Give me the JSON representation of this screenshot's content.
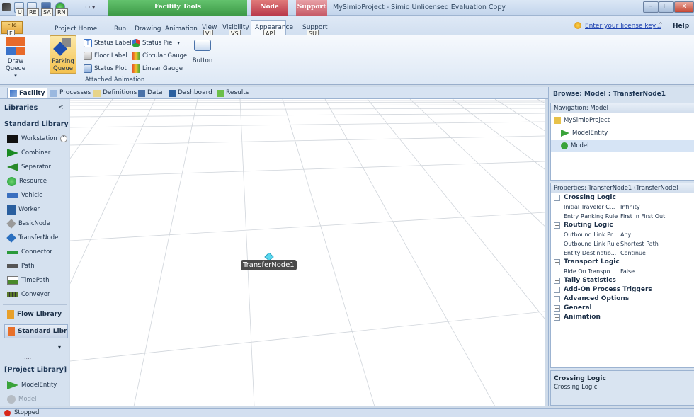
{
  "window": {
    "title": "MySimioProject - Simio Unlicensed Evaluation Copy",
    "context_tabs": [
      "Facility Tools",
      "Node Tools",
      "Support"
    ],
    "min": "–",
    "max": "□",
    "close": "x"
  },
  "qat_keytips": [
    "U",
    "RE",
    "SA",
    "RN"
  ],
  "ribbon_tabs": [
    {
      "label": "File",
      "keytip": "F"
    },
    {
      "label": "Project Home",
      "keytip": ""
    },
    {
      "label": "Run",
      "keytip": ""
    },
    {
      "label": "Drawing",
      "keytip": ""
    },
    {
      "label": "Animation",
      "keytip": ""
    },
    {
      "label": "View",
      "keytip": "VI"
    },
    {
      "label": "Visibility",
      "keytip": "VS"
    },
    {
      "label": "Appearance",
      "keytip": "AP"
    },
    {
      "label": "Support",
      "keytip": "SU"
    }
  ],
  "license": {
    "link": "Enter your license key...",
    "help": "Help"
  },
  "ribbon": {
    "draw_queue": "Draw Queue",
    "parking_queue": "Parking Queue",
    "status_label": "Status Label",
    "floor_label": "Floor Label",
    "status_plot": "Status Plot",
    "status_pie": "Status Pie",
    "circular_gauge": "Circular Gauge",
    "linear_gauge": "Linear Gauge",
    "button": "Button",
    "group_label": "Attached Animation"
  },
  "doc_tabs": [
    "Facility",
    "Processes",
    "Definitions",
    "Data",
    "Dashboard",
    "Results"
  ],
  "libraries": {
    "header": "Libraries",
    "collapse": "<",
    "standard_header": "Standard Library",
    "items": [
      {
        "label": "Workstation",
        "icon": "workstation-icon",
        "color": "#1a8a22"
      },
      {
        "label": "Combiner",
        "icon": "combiner-icon",
        "color": "#1a8a22"
      },
      {
        "label": "Separator",
        "icon": "separator-icon",
        "color": "#2a8a2a"
      },
      {
        "label": "Resource",
        "icon": "resource-icon",
        "color": "#1f9a3a"
      },
      {
        "label": "Vehicle",
        "icon": "vehicle-icon",
        "color": "#3a6fbf"
      },
      {
        "label": "Worker",
        "icon": "worker-icon",
        "color": "#2a5f9f"
      },
      {
        "label": "BasicNode",
        "icon": "basicnode-icon",
        "color": "#9a9a9a"
      },
      {
        "label": "TransferNode",
        "icon": "transfernode-icon",
        "color": "#2a6fbf"
      },
      {
        "label": "Connector",
        "icon": "connector-icon",
        "color": "#2a9a3a"
      },
      {
        "label": "Path",
        "icon": "path-icon",
        "color": "#555555"
      },
      {
        "label": "TimePath",
        "icon": "timepath-icon",
        "color": "#4a8a2a"
      },
      {
        "label": "Conveyor",
        "icon": "conveyor-icon",
        "color": "#5a7a2a"
      }
    ],
    "flow_library": "Flow Library",
    "standard_library_btn": "Standard Libr",
    "more": "....",
    "project_header": "[Project Library]",
    "project_items": [
      "ModelEntity",
      "Model"
    ]
  },
  "canvas": {
    "node_label": "TransferNode1"
  },
  "browse": {
    "title": "Browse: Model : TransferNode1",
    "nav_header": "Navigation: Model",
    "nav_items": [
      "MySimioProject",
      "ModelEntity",
      "Model"
    ],
    "props_header": "Properties: TransferNode1 (TransferNode)",
    "properties": [
      {
        "type": "cat",
        "sign": "−",
        "label": "Crossing Logic"
      },
      {
        "type": "prop",
        "label": "Initial Traveler C...",
        "value": "Infinity"
      },
      {
        "type": "prop",
        "label": "Entry Ranking Rule",
        "value": "First In First Out"
      },
      {
        "type": "cat",
        "sign": "−",
        "label": "Routing Logic"
      },
      {
        "type": "prop",
        "label": "Outbound Link Pr...",
        "value": "Any"
      },
      {
        "type": "prop",
        "label": "Outbound Link Rule",
        "value": "Shortest Path"
      },
      {
        "type": "prop",
        "label": "Entity Destinatio...",
        "value": "Continue"
      },
      {
        "type": "cat",
        "sign": "−",
        "label": "Transport Logic"
      },
      {
        "type": "prop",
        "label": "Ride On Transpo...",
        "value": "False"
      },
      {
        "type": "cat",
        "sign": "+",
        "label": "Tally Statistics"
      },
      {
        "type": "cat",
        "sign": "+",
        "label": "Add-On Process Triggers"
      },
      {
        "type": "cat",
        "sign": "+",
        "label": "Advanced Options"
      },
      {
        "type": "cat",
        "sign": "+",
        "label": "General"
      },
      {
        "type": "cat",
        "sign": "+",
        "label": "Animation"
      }
    ],
    "desc_title": "Crossing Logic",
    "desc_text": "Crossing Logic"
  },
  "status": {
    "text": "Stopped"
  }
}
